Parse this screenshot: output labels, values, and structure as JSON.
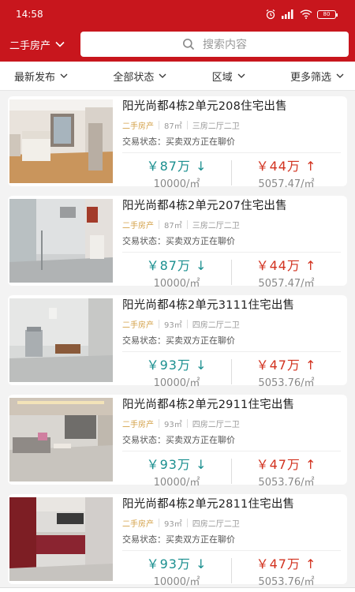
{
  "status": {
    "time": "14:58",
    "battery": "80"
  },
  "header": {
    "city_label": "二手房产",
    "search_placeholder": "搜索内容"
  },
  "filters": [
    {
      "label": "最新发布"
    },
    {
      "label": "全部状态"
    },
    {
      "label": "区域"
    },
    {
      "label": "更多筛选"
    }
  ],
  "colors": {
    "brand": "#c8161d",
    "teal": "#1a8f8f",
    "red": "#d2321f",
    "tag": "#d4a24a"
  },
  "listings": [
    {
      "title": "阳光尚都4栋2单元208住宅出售",
      "type": "二手房产",
      "area": "87㎡",
      "layout": "三房二厅二卫",
      "status": "交易状态：买卖双方正在聊价",
      "price_left": "￥87万",
      "unit_left": "10000/㎡",
      "price_right": "￥44万",
      "unit_right": "5057.47/㎡"
    },
    {
      "title": "阳光尚都4栋2单元207住宅出售",
      "type": "二手房产",
      "area": "87㎡",
      "layout": "三房二厅二卫",
      "status": "交易状态：买卖双方正在聊价",
      "price_left": "￥87万",
      "unit_left": "10000/㎡",
      "price_right": "￥44万",
      "unit_right": "5057.47/㎡"
    },
    {
      "title": "阳光尚都4栋2单元3111住宅出售",
      "type": "二手房产",
      "area": "93㎡",
      "layout": "四房二厅二卫",
      "status": "交易状态：买卖双方正在聊价",
      "price_left": "￥93万",
      "unit_left": "10000/㎡",
      "price_right": "￥47万",
      "unit_right": "5053.76/㎡"
    },
    {
      "title": "阳光尚都4栋2单元2911住宅出售",
      "type": "二手房产",
      "area": "93㎡",
      "layout": "四房二厅二卫",
      "status": "交易状态：买卖双方正在聊价",
      "price_left": "￥93万",
      "unit_left": "10000/㎡",
      "price_right": "￥47万",
      "unit_right": "5053.76/㎡"
    },
    {
      "title": "阳光尚都4栋2单元2811住宅出售",
      "type": "二手房产",
      "area": "93㎡",
      "layout": "四房二厅二卫",
      "status": "交易状态：买卖双方正在聊价",
      "price_left": "￥93万",
      "unit_left": "10000/㎡",
      "price_right": "￥47万",
      "unit_right": "5053.76/㎡"
    }
  ]
}
